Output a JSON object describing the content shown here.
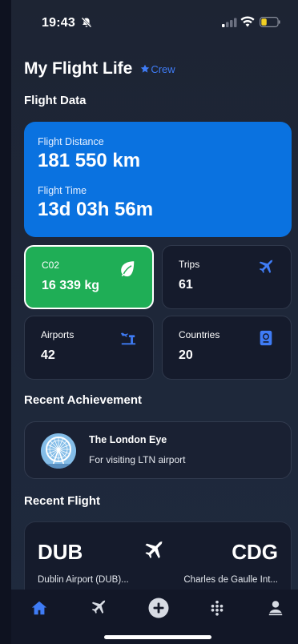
{
  "status_bar": {
    "time": "19:43"
  },
  "header": {
    "title": "My Flight Life",
    "badge": "Crew"
  },
  "flight_data": {
    "section_title": "Flight Data",
    "distance_label": "Flight Distance",
    "distance_value": "181 550 km",
    "time_label": "Flight Time",
    "time_value": "13d 03h 56m",
    "tiles": [
      {
        "label": "C02",
        "value": "16 339 kg",
        "icon": "leaf-icon"
      },
      {
        "label": "Trips",
        "value": "61",
        "icon": "airplane-icon"
      },
      {
        "label": "Airports",
        "value": "42",
        "icon": "airport-tower-icon"
      },
      {
        "label": "Countries",
        "value": "20",
        "icon": "passport-icon"
      }
    ]
  },
  "achievement": {
    "section_title": "Recent Achievement",
    "title": "The London Eye",
    "description": "For visiting LTN airport"
  },
  "recent_flight": {
    "section_title": "Recent Flight",
    "from_code": "DUB",
    "from_name": "Dublin Airport (DUB)...",
    "to_code": "CDG",
    "to_name": "Charles de Gaulle Int..."
  },
  "tabs": [
    {
      "name": "home",
      "active": true
    },
    {
      "name": "flights",
      "active": false
    },
    {
      "name": "add",
      "active": false
    },
    {
      "name": "stats",
      "active": false
    },
    {
      "name": "profile",
      "active": false
    }
  ],
  "colors": {
    "accent": "#3f7cf6",
    "hero_blue": "#0a72e0",
    "co2_green": "#1fae56",
    "tile_bg": "#151b2c"
  }
}
